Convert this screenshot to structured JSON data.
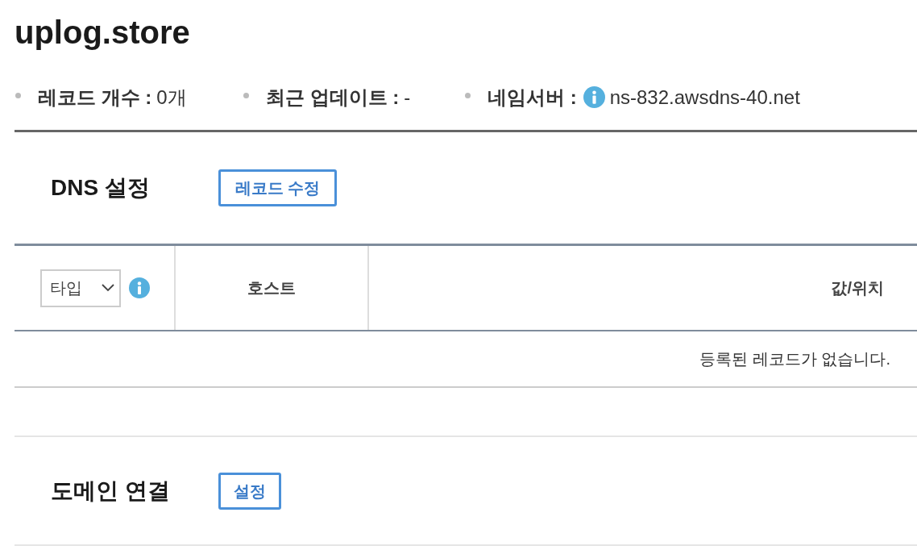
{
  "page": {
    "title": "uplog.store"
  },
  "summary": [
    {
      "label": "레코드 개수 :",
      "value": "0개",
      "info_icon": false
    },
    {
      "label": "최근 업데이트 :",
      "value": "-",
      "info_icon": false
    },
    {
      "label": "네임서버 :",
      "value": "ns-832.awsdns-40.net",
      "info_icon": true
    }
  ],
  "dns_section": {
    "title": "DNS 설정",
    "button": "레코드 수정",
    "table": {
      "type_select": {
        "value": "타입"
      },
      "columns": [
        "호스트",
        "값/위치"
      ],
      "empty_message": "등록된 레코드가 없습니다."
    }
  },
  "domain_section": {
    "title": "도메인 연결",
    "button": "설정"
  }
}
